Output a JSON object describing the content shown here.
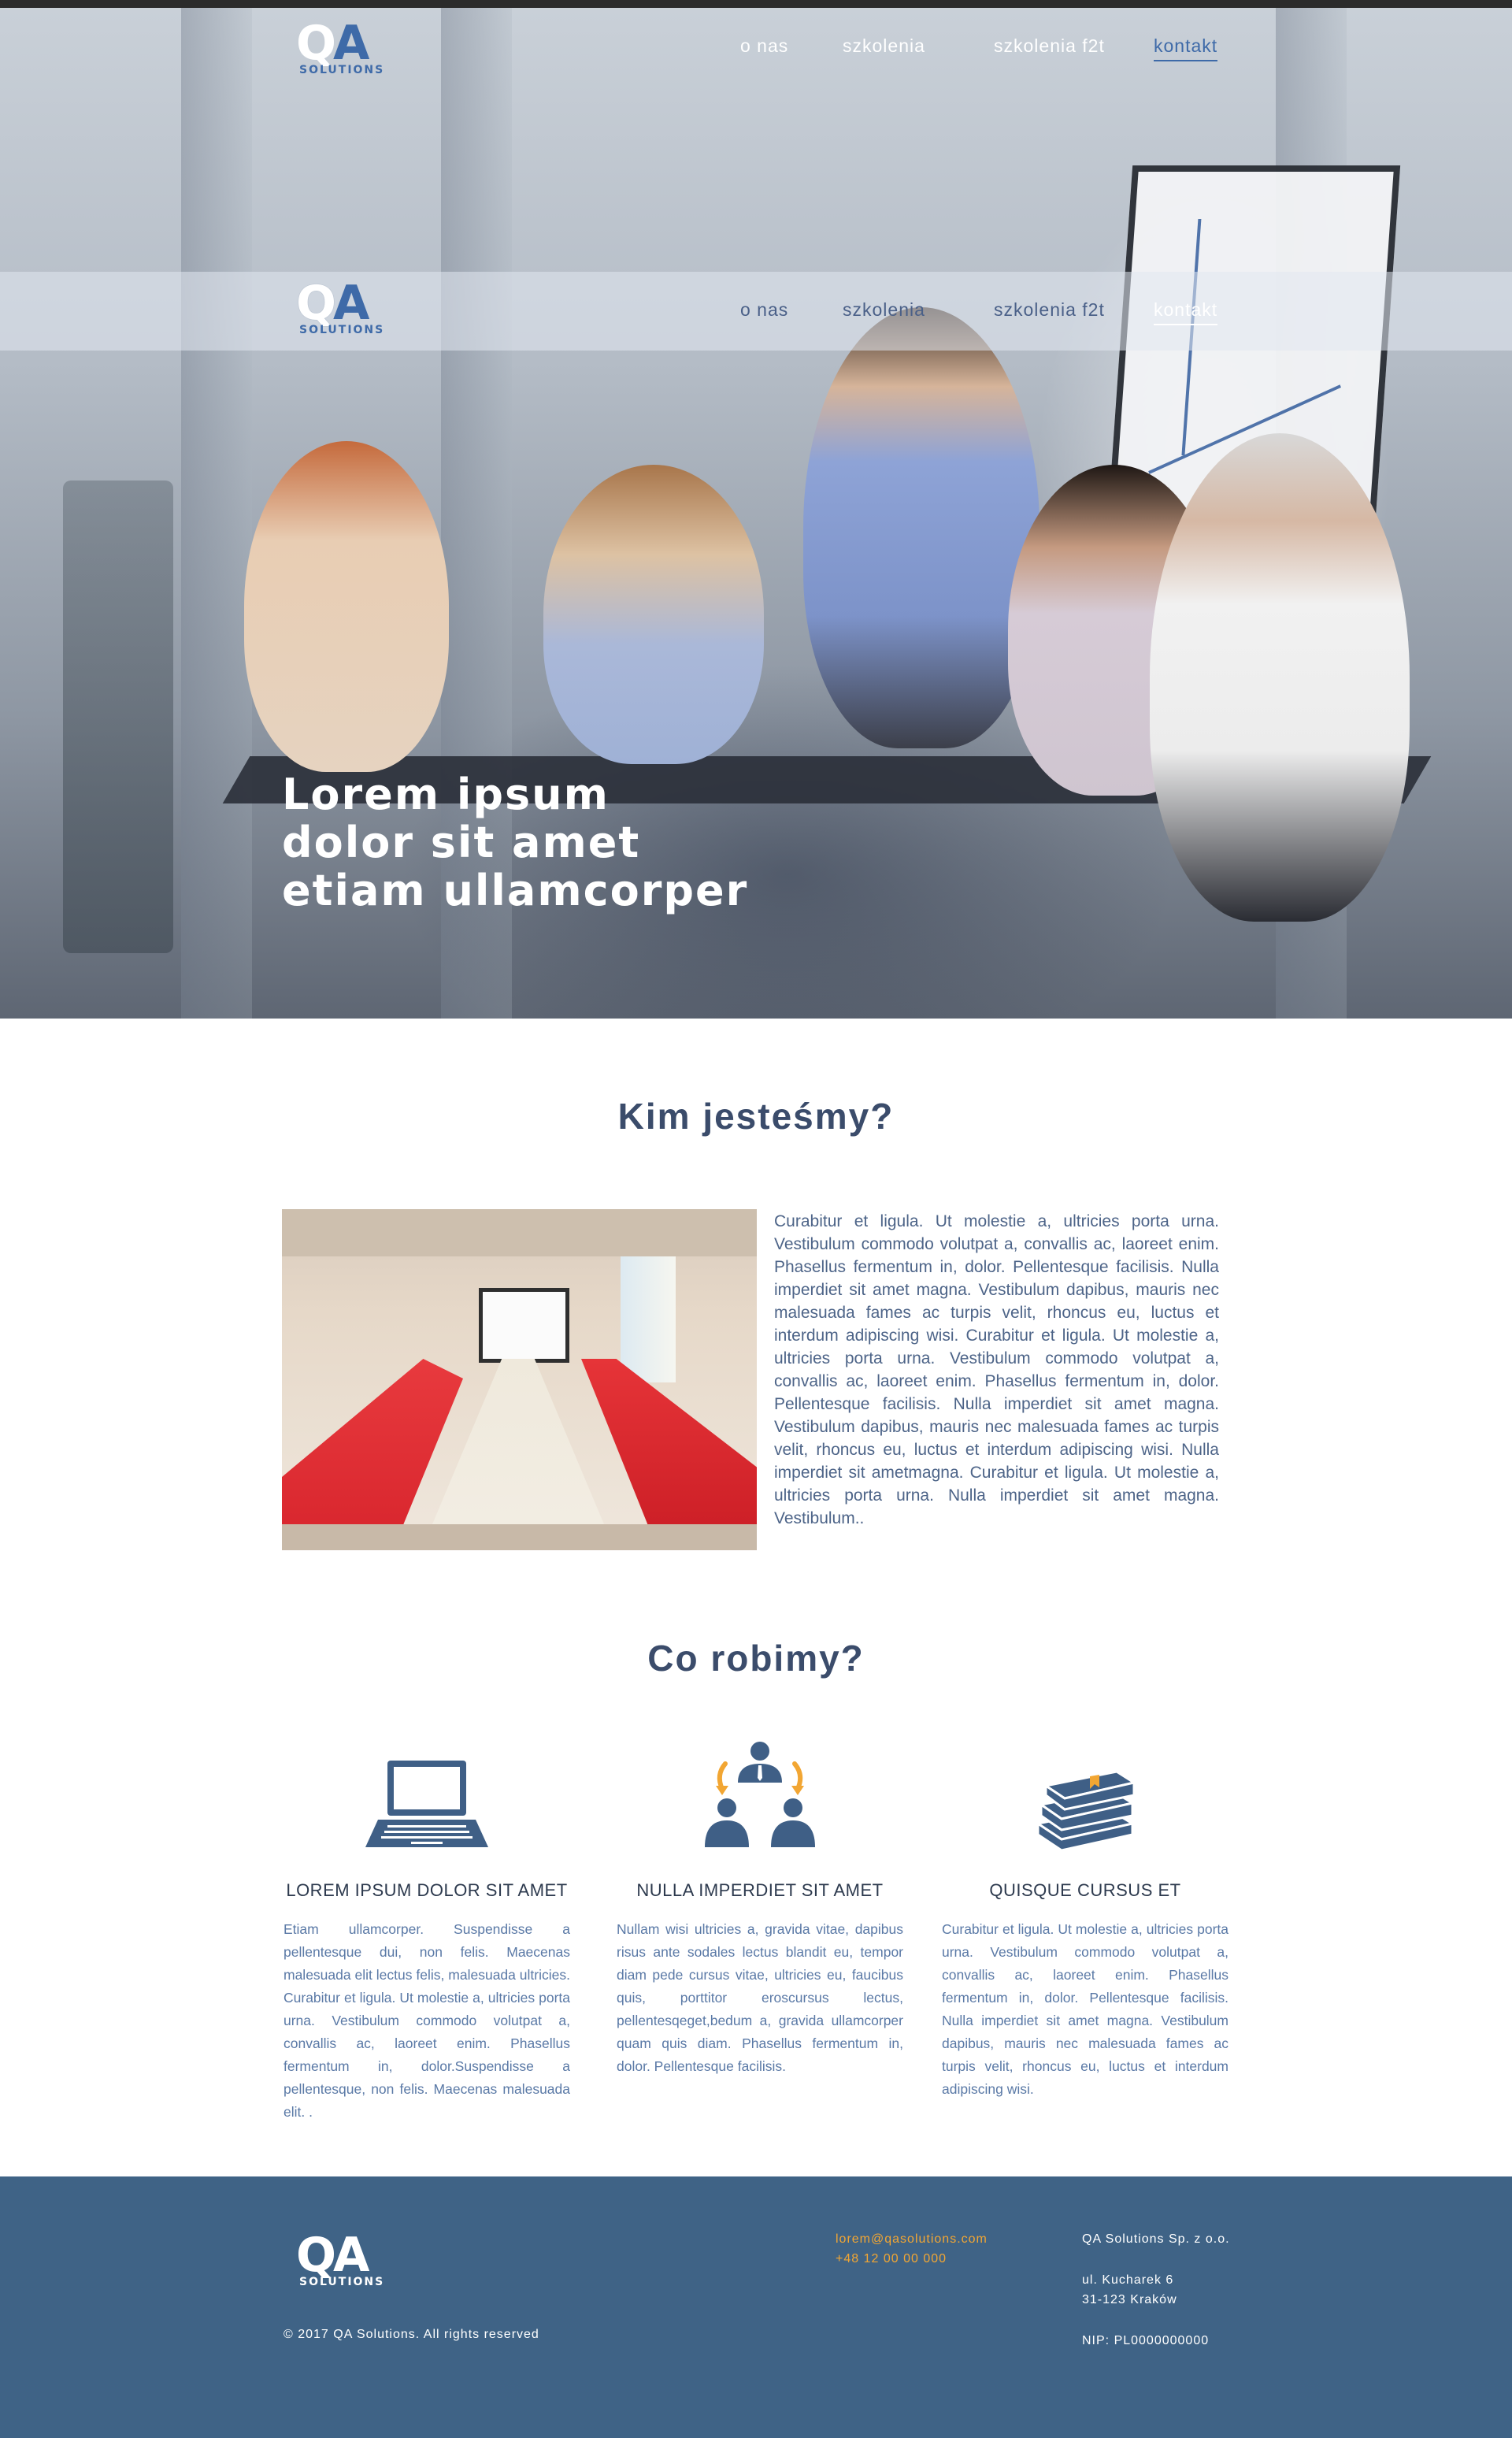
{
  "nav": {
    "logo_q": "Q",
    "logo_a": "A",
    "logo_sub": "SOLUTIONS",
    "items": [
      "o nas",
      "szkolenia",
      "szkolenia f2t",
      "kontakt"
    ],
    "active": "kontakt"
  },
  "hero": {
    "headline": [
      "Lorem ipsum",
      "dolor sit amet",
      "etiam ullamcorper"
    ]
  },
  "about": {
    "title": "Kim jesteśmy?",
    "text": "Curabitur et ligula. Ut molestie a, ultricies porta urna. Vestibulum commodo volutpat a, convallis ac, laoreet enim. Phasellus fermentum in, dolor. Pellentesque facilisis. Nulla imperdiet sit amet magna. Vestibulum dapibus, mauris nec malesuada fames ac turpis velit, rhoncus eu, luctus et interdum adipiscing wisi. Curabitur et ligula. Ut molestie a, ultricies porta urna. Vestibulum commodo volutpat a, convallis ac, laoreet enim. Phasellus fermentum in, dolor. Pellentesque facilisis. Nulla imperdiet sit amet magna. Vestibulum dapibus, mauris nec malesuada fames ac turpis velit, rhoncus eu, luctus et interdum adipiscing wisi. Nulla imperdiet sit ametmagna. Curabitur et ligula. Ut molestie a, ultricies porta urna. Nulla imperdiet sit amet magna. Vestibulum.."
  },
  "services": {
    "title": "Co robimy?",
    "items": [
      {
        "icon": "laptop-icon",
        "title": "LOREM IPSUM DOLOR SIT AMET",
        "body": "Etiam ullamcorper. Suspendisse a pellentesque dui, non felis. Maecenas malesuada elit lectus felis, malesuada ultricies. Curabitur et ligula. Ut molestie a, ultricies porta urna. Vestibulum commodo volutpat a, convallis ac, laoreet enim. Phasellus fermentum in, dolor.Suspendisse a pellentesque, non felis. Maecenas malesuada elit. ."
      },
      {
        "icon": "team-icon",
        "title": "NULLA IMPERDIET SIT AMET",
        "body": "Nullam wisi ultricies a, gravida vitae, dapibus risus ante sodales lectus blandit eu, tempor diam pede cursus vitae, ultricies eu, faucibus quis, porttitor eroscursus lectus, pellentesqeget,bedum a, gravida ullamcorper quam quis diam. Phasellus fermentum in, dolor. Pellentesque facilisis."
      },
      {
        "icon": "books-icon",
        "title": "QUISQUE CURSUS ET",
        "body": "Curabitur et ligula. Ut molestie a, ultricies porta urna. Vestibulum commodo volutpat a, convallis ac, laoreet enim. Phasellus fermentum in, dolor. Pellentesque facilisis. Nulla imperdiet sit amet magna. Vestibulum dapibus, mauris nec malesuada fames ac turpis velit, rhoncus eu, luctus et interdum adipiscing wisi."
      }
    ]
  },
  "footer": {
    "copyright": "© 2017 QA Solutions. All rights reserved",
    "email": "lorem@qasolutions.com",
    "phone": "+48 12 00 00 000",
    "company": "QA Solutions Sp. z o.o.",
    "street": "ul. Kucharek 6",
    "city": "31-123 Kraków",
    "nip": "NIP: PL0000000000"
  },
  "colors": {
    "brand_blue": "#3e6aa8",
    "footer_bg": "#3f6386",
    "accent_orange": "#f2a633",
    "heading": "#3b4c6b"
  }
}
